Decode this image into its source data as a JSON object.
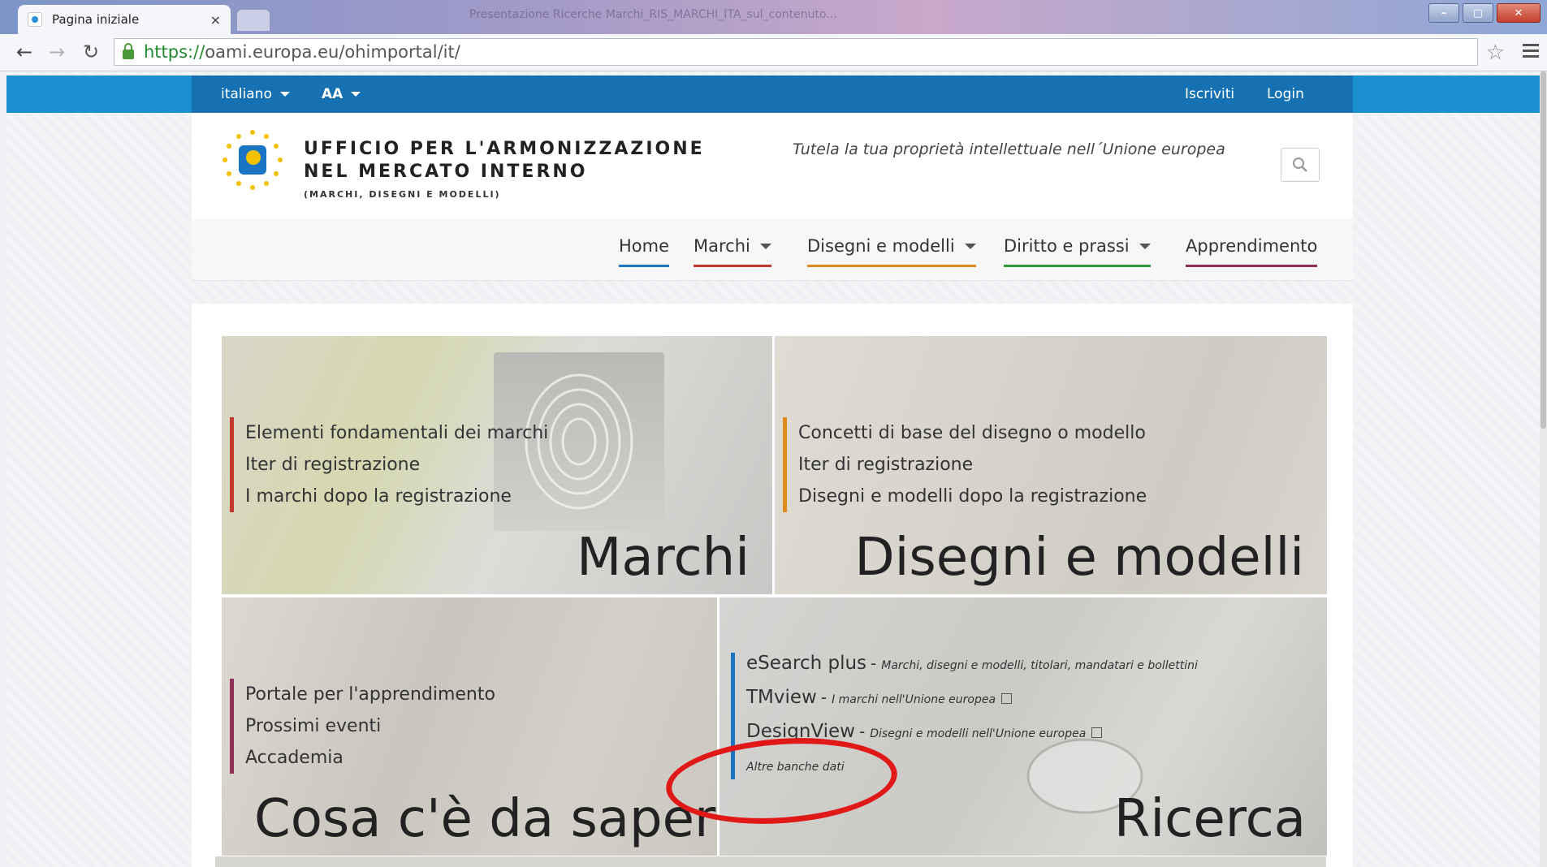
{
  "browser": {
    "tab_title": "Pagina iniziale",
    "tab_close": "×",
    "window_title": "Presentazione Ricerche Marchi_RIS_MARCHI_ITA_sul_contenuto...",
    "url_scheme": "https://",
    "url_rest": "oami.europa.eu/ohimportal/it/",
    "buttons": {
      "minimize": "–",
      "maximize": "▢",
      "close": "✕"
    }
  },
  "topbar": {
    "language": "italiano",
    "font_size": "AA",
    "register": "Iscriviti",
    "login": "Login"
  },
  "header": {
    "org_line1": "UFFICIO PER L'ARMONIZZAZIONE",
    "org_line2": "NEL MERCATO INTERNO",
    "org_line3": "(MARCHI, DISEGNI E MODELLI)",
    "tagline": "Tutela la tua proprietà intellettuale nell´Unione europea"
  },
  "nav": {
    "items": [
      {
        "label": "Home",
        "underline": "#1b75c5"
      },
      {
        "label": "Marchi",
        "underline": "#c0392b",
        "dropdown": true
      },
      {
        "label": "Disegni e modelli",
        "underline": "#e08a1e",
        "dropdown": true
      },
      {
        "label": "Diritto e prassi",
        "underline": "#2e9a3a",
        "dropdown": true
      },
      {
        "label": "Apprendimento",
        "underline": "#8e2f5a"
      }
    ]
  },
  "tiles": {
    "marchi": {
      "title": "Marchi",
      "accent": "#c0392b",
      "links": [
        "Elementi fondamentali dei marchi",
        "Iter di registrazione",
        "I marchi dopo la registrazione"
      ]
    },
    "disegni": {
      "title": "Disegni e modelli",
      "accent": "#e08a1e",
      "links": [
        "Concetti di base del disegno o modello",
        "Iter di registrazione",
        "Disegni e modelli dopo la registrazione"
      ]
    },
    "cosa": {
      "title": "Cosa c'è da sapere",
      "accent": "#8e2f5a",
      "links": [
        "Portale per l'apprendimento",
        "Prossimi eventi",
        "Accademia"
      ]
    },
    "ricerca": {
      "title": "Ricerca",
      "accent": "#1b75c5",
      "items": [
        {
          "name": "eSearch plus",
          "sep": "-",
          "desc": "Marchi, disegni e modelli, titolari, mandatari e bollettini"
        },
        {
          "name": "TMview",
          "sep": "-",
          "desc": "I marchi nell'Unione europea"
        },
        {
          "name": "DesignView",
          "sep": "-",
          "desc": "Disegni e modelli nell'Unione europea"
        }
      ],
      "more": "Altre banche dati"
    }
  }
}
